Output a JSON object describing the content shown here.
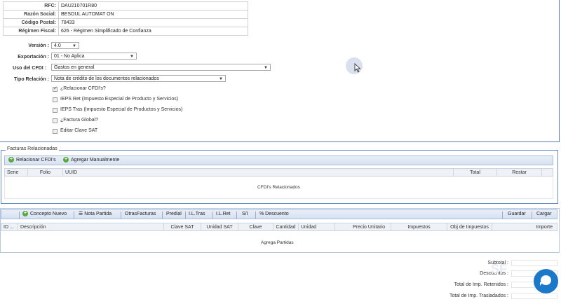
{
  "receptor": {
    "rows": [
      {
        "label": "RFC:",
        "value": "DAU210701R80"
      },
      {
        "label": "Razón Social:",
        "value": "BESOUL AUTOMAT ON"
      },
      {
        "label": "Código Postal:",
        "value": "78433"
      },
      {
        "label": "Régimen Fiscal:",
        "value": "626 - Régimen Simplificado de Confianza"
      }
    ]
  },
  "form": {
    "version": {
      "label": "Versión :",
      "value": "4.0"
    },
    "exportacion": {
      "label": "Exportación :",
      "value": "01 - No Aplica"
    },
    "uso_cfdi": {
      "label": "Uso del CFDI :",
      "value": "Gastos en general"
    },
    "tipo_relacion": {
      "label": "Tipo Relación :",
      "value": "Nota de crédito de los documentos relacionados"
    },
    "checkboxes": [
      {
        "label": "¿Relacionar CFDI's?",
        "checked": true
      },
      {
        "label": "IEPS Ret (Impuesto Especial de Producto y Servicios)",
        "checked": false
      },
      {
        "label": "IEPS Tras (Impuesto Especial de Productos y Servicios)",
        "checked": false
      },
      {
        "label": "¿Factura Global?",
        "checked": false
      },
      {
        "label": "Editar Clave SAT",
        "checked": false
      }
    ]
  },
  "relacionadas": {
    "legend": "Facturas Relacionadas",
    "btn_relacionar": "Relacionar CFDI's",
    "btn_agregar": "Agregar Manualmente",
    "columns": [
      "Serie",
      "Folio",
      "UUID",
      "Total",
      "Restar"
    ],
    "empty": "CFDI's Relacionados"
  },
  "conceptos": {
    "toolbar": [
      "Concepto Nuevo",
      "Nota Partida",
      "OtrasFacturas",
      "Predial",
      "I.L.Tras",
      "I.L.Ret",
      "S/I",
      "% Descuento"
    ],
    "guardar": "Guardar",
    "cargar": "Cargar",
    "columns": [
      "ID ...",
      "Descripción",
      "Clave SAT",
      "Unidad SAT",
      "Clave",
      "Cantidad",
      "Unidad",
      "Precio Unitario",
      "Impuestos",
      "Obj de Impuestos",
      "Importe"
    ],
    "empty": "Agrega Partidas"
  },
  "totales": {
    "subtotal": "Subtotal :",
    "descuentos": "Descuentos :",
    "retenidos": "Total de Imp. Retenidos :",
    "trasladados": "Total de Imp. Trasladados :"
  }
}
